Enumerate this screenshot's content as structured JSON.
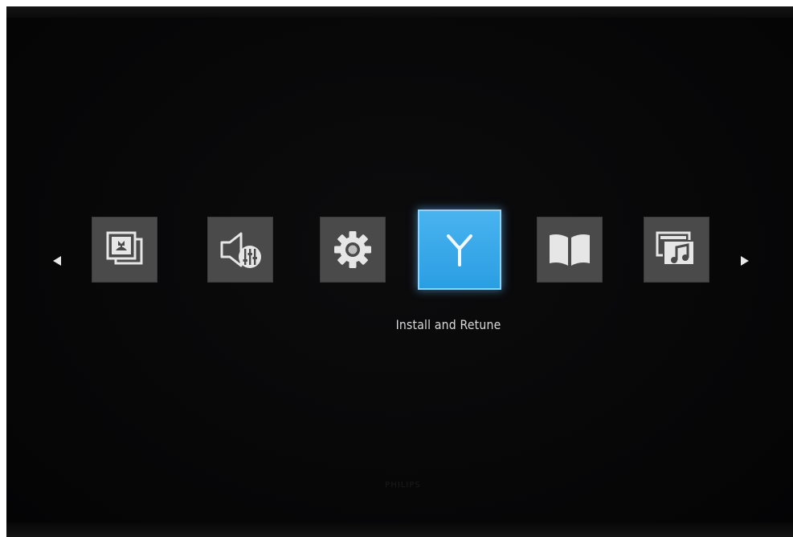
{
  "menu": {
    "tiles": [
      {
        "name": "picture",
        "icon": "picture-icon",
        "selected": false
      },
      {
        "name": "sound",
        "icon": "speaker-equalizer-icon",
        "selected": false
      },
      {
        "name": "settings",
        "icon": "gear-icon",
        "selected": false
      },
      {
        "name": "install-and-retune",
        "icon": "antenna-icon",
        "selected": true
      },
      {
        "name": "help",
        "icon": "open-book-icon",
        "selected": false
      },
      {
        "name": "media",
        "icon": "media-screen-music-icon",
        "selected": false
      }
    ],
    "selected_label": "Install and Retune",
    "nav_left_icon": "triangle-left-icon",
    "nav_right_icon": "triangle-right-icon"
  },
  "brand": {
    "watermark": "PHILIPS"
  },
  "colors": {
    "background": "#070708",
    "tile_default": "#4a4a4b",
    "tile_selected": "#2a9ee3",
    "icon_light": "#e6e6e6",
    "caption_text": "#d9d9d9"
  }
}
